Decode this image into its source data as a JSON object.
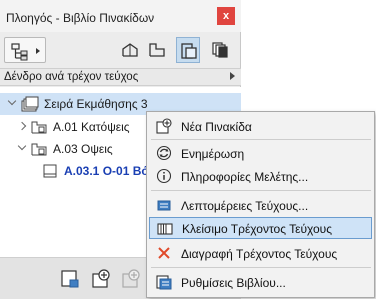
{
  "window": {
    "title": "Πλοηγός - Βιβλίο Πινακίδων",
    "close_label": "x"
  },
  "view_selector": {
    "label": "Δένδρο ανά τρέχον τεύχος"
  },
  "tree": {
    "items": [
      {
        "label": "Σειρά Εκμάθησης 3"
      },
      {
        "label": "Α.01 Κατόψεις"
      },
      {
        "label": "Α.03 Οψεις"
      },
      {
        "label": "Α.03.1 Ο-01 Βόρ"
      }
    ]
  },
  "context_menu": {
    "items": [
      {
        "label": "Νέα Πινακίδα",
        "icon": "new-sheet-icon"
      },
      {
        "label": "Ενημέρωση",
        "icon": "refresh-icon"
      },
      {
        "label": "Πληροφορίες Μελέτης...",
        "icon": "info-icon"
      },
      {
        "label": "Λεπτομέρειες Τεύχους...",
        "icon": "issue-details-icon"
      },
      {
        "label": "Κλείσιμο Τρέχοντος Τεύχους",
        "icon": "close-issue-icon"
      },
      {
        "label": "Διαγραφή Τρέχοντος Τεύχους",
        "icon": "delete-x-icon"
      },
      {
        "label": "Ρυθμίσεις Βιβλίου...",
        "icon": "book-settings-icon"
      }
    ]
  },
  "colors": {
    "accent_blue": "#1a3fb3",
    "selection": "#cfe2f6",
    "close_red": "#e0453f",
    "delete_red": "#e04a2a"
  }
}
